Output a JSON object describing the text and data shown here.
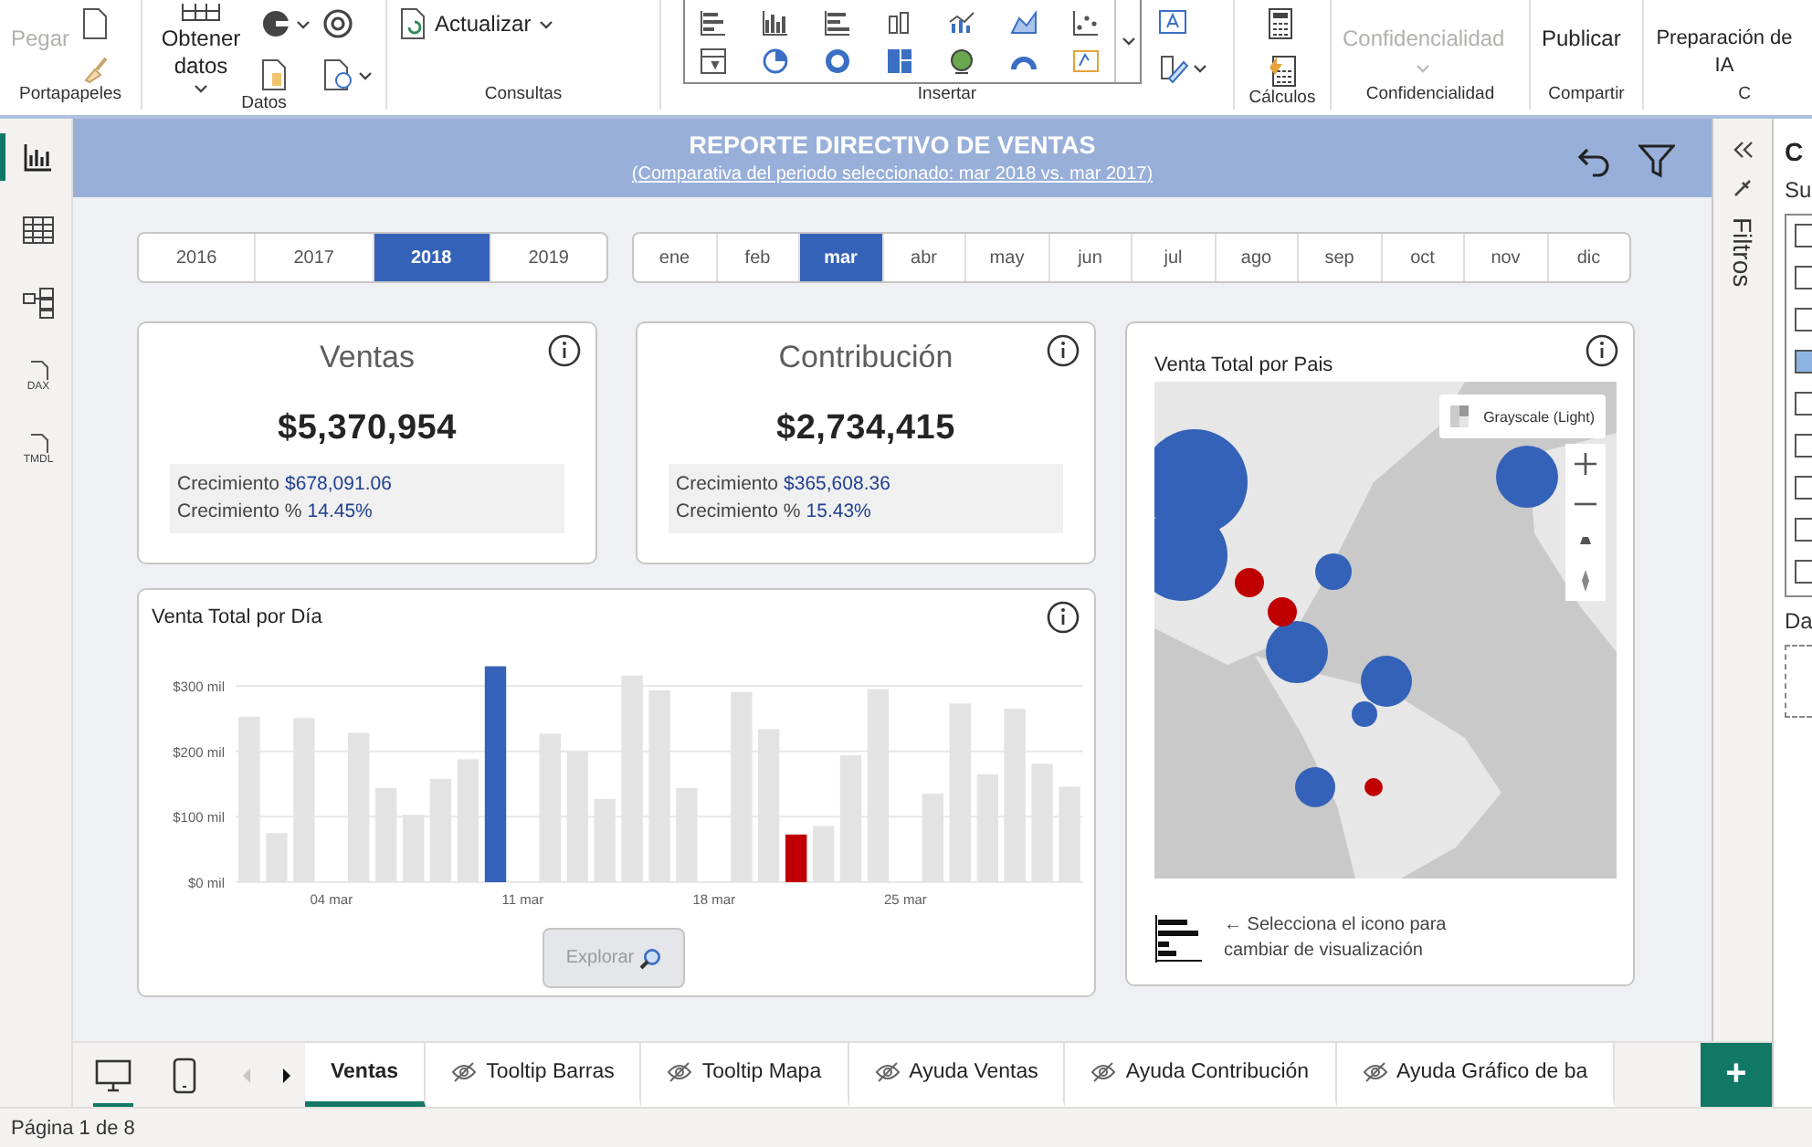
{
  "ribbon": {
    "groups": [
      {
        "label": "Portapapeles",
        "kind": "clipboard",
        "buttons": [
          {
            "label": "Pegar",
            "disabled": true
          }
        ]
      },
      {
        "label": "Datos",
        "kind": "data",
        "buttons": [
          {
            "label": "Obtener datos",
            "disabled": false
          }
        ]
      },
      {
        "label": "Consultas",
        "kind": "queries",
        "buttons": [
          {
            "label": "Actualizar",
            "disabled": false
          }
        ]
      },
      {
        "label": "Insertar",
        "kind": "insert"
      },
      {
        "label": "Cálculos",
        "kind": "calc"
      },
      {
        "label": "Confidencialidad",
        "kind": "sensitivity",
        "buttons": [
          {
            "label": "Confidencialidad",
            "disabled": true
          }
        ]
      },
      {
        "label": "Compartir",
        "kind": "share",
        "buttons": [
          {
            "label": "Publicar",
            "disabled": false
          }
        ]
      },
      {
        "label": "C",
        "kind": "ai",
        "buttons": [
          {
            "label": "Preparación de IA",
            "disabled": false
          }
        ]
      }
    ]
  },
  "nav": {
    "items": [
      {
        "kind": "report",
        "selected": true
      },
      {
        "kind": "table",
        "selected": false
      },
      {
        "kind": "model",
        "selected": false
      },
      {
        "kind": "dax",
        "label": "DAX",
        "selected": false
      },
      {
        "kind": "tmdl",
        "label": "TMDL",
        "selected": false
      }
    ]
  },
  "report": {
    "header": {
      "title": "REPORTE DIRECTIVO DE VENTAS",
      "subtitle": "(Comparativa del periodo seleccionado: mar 2018 vs. mar 2017)"
    },
    "years": [
      {
        "label": "2016",
        "selected": false
      },
      {
        "label": "2017",
        "selected": false
      },
      {
        "label": "2018",
        "selected": true
      },
      {
        "label": "2019",
        "selected": false
      }
    ],
    "months": [
      {
        "label": "ene",
        "selected": false
      },
      {
        "label": "feb",
        "selected": false
      },
      {
        "label": "mar",
        "selected": true
      },
      {
        "label": "abr",
        "selected": false
      },
      {
        "label": "may",
        "selected": false
      },
      {
        "label": "jun",
        "selected": false
      },
      {
        "label": "jul",
        "selected": false
      },
      {
        "label": "ago",
        "selected": false
      },
      {
        "label": "sep",
        "selected": false
      },
      {
        "label": "oct",
        "selected": false
      },
      {
        "label": "nov",
        "selected": false
      },
      {
        "label": "dic",
        "selected": false
      }
    ],
    "cards": [
      {
        "title": "Ventas",
        "value": "$5,370,954",
        "growth": [
          {
            "label": "Crecimiento",
            "value": "$678,091.06"
          },
          {
            "label": "Crecimiento %",
            "value": "14.45%"
          }
        ]
      },
      {
        "title": "Contribución",
        "value": "$2,734,415",
        "growth": [
          {
            "label": "Crecimiento",
            "value": "$365,608.36"
          },
          {
            "label": "Crecimiento %",
            "value": "15.43%"
          }
        ]
      }
    ],
    "daily_chart": {
      "chart_data": {
        "type": "bar",
        "title": "Venta Total por Día",
        "grid": true,
        "categories": [
          null,
          null,
          null,
          "04 mar",
          null,
          null,
          null,
          null,
          null,
          null,
          "11 mar",
          null,
          null,
          null,
          null,
          null,
          null,
          "18 mar",
          null,
          null,
          null,
          null,
          null,
          null,
          "25 mar",
          null,
          null,
          null,
          null,
          null,
          null
        ],
        "series": [
          {
            "color": "#e3e3e3",
            "values": [
              253,
              75,
              251,
              null,
              228,
              144,
              103,
              158,
              188,
              null,
              null,
              227,
              200,
              127,
              316,
              293,
              144,
              null,
              291,
              234,
              null,
              86,
              194,
              295,
              null,
              135,
              273,
              165,
              265,
              181,
              146
            ]
          },
          {
            "color": "#3462b8",
            "values": [
              null,
              null,
              null,
              null,
              null,
              null,
              null,
              null,
              null,
              330,
              null,
              null,
              null,
              null,
              null,
              null,
              null,
              null,
              null,
              null,
              null,
              null,
              null,
              null,
              null,
              null,
              null,
              null,
              null,
              null,
              null
            ]
          },
          {
            "color": "#c00000",
            "values": [
              null,
              null,
              null,
              null,
              null,
              null,
              null,
              null,
              null,
              null,
              null,
              null,
              null,
              null,
              null,
              null,
              null,
              null,
              null,
              null,
              73,
              null,
              null,
              null,
              null,
              null,
              null,
              null,
              null,
              null,
              null
            ]
          }
        ],
        "ylim": [
          0,
          335
        ],
        "yticks": [
          {
            "value": 0,
            "label": "$0 mil"
          },
          {
            "value": 100,
            "label": "$100 mil"
          },
          {
            "value": 200,
            "label": "$200 mil"
          },
          {
            "value": 300,
            "label": "$300 mil"
          }
        ]
      },
      "explore_button": {
        "label": "Explorar",
        "disabled": true
      }
    },
    "map": {
      "title": "Venta Total por Pais",
      "style_button": "Grayscale (Light)",
      "hint": "← Selecciona el icono para cambiar de visualización"
    }
  },
  "filters_pane": {
    "title": "Filtros"
  },
  "side_pane": {
    "title": "C",
    "section_1": "Su",
    "section_2": "Da"
  },
  "page_bar": {
    "views": [
      {
        "kind": "desktop",
        "selected": true
      },
      {
        "kind": "mobile",
        "selected": false
      }
    ],
    "arrows": [
      {
        "kind": "prev",
        "disabled": true
      },
      {
        "kind": "next",
        "disabled": false
      }
    ],
    "tabs": [
      {
        "label": "Ventas",
        "selected": true,
        "hidden": false
      },
      {
        "label": "Tooltip Barras",
        "selected": false,
        "hidden": true
      },
      {
        "label": "Tooltip Mapa",
        "selected": false,
        "hidden": true
      },
      {
        "label": "Ayuda Ventas",
        "selected": false,
        "hidden": true
      },
      {
        "label": "Ayuda Contribución",
        "selected": false,
        "hidden": true
      },
      {
        "label": "Ayuda Gráfico de ba",
        "selected": false,
        "hidden": true
      }
    ],
    "add_button": "+"
  },
  "status_bar": {
    "text": "Página 1 de 8"
  }
}
